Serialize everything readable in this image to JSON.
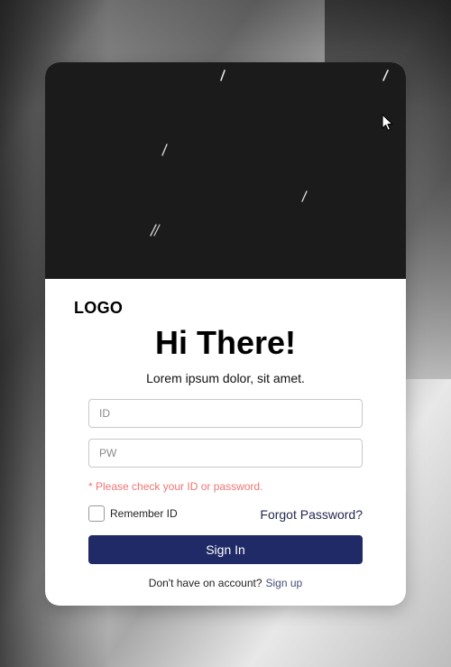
{
  "logo": "LOGO",
  "title": "Hi There!",
  "subtitle": "Lorem ipsum dolor, sit amet.",
  "fields": {
    "id_placeholder": "ID",
    "pw_placeholder": "PW"
  },
  "error_message": "* Please check your ID or password.",
  "remember_label": "Remember ID",
  "forgot_label": "Forgot Password?",
  "signin_label": "Sign In",
  "signup": {
    "prompt": "Don't have on account?",
    "link": "Sign up"
  },
  "colors": {
    "hero_bg": "#1b1b1b",
    "primary_button": "#1f2a66",
    "error": "#f07474",
    "link": "#222a4f"
  },
  "icons": {
    "cursor": "mouse-pointer-icon"
  }
}
